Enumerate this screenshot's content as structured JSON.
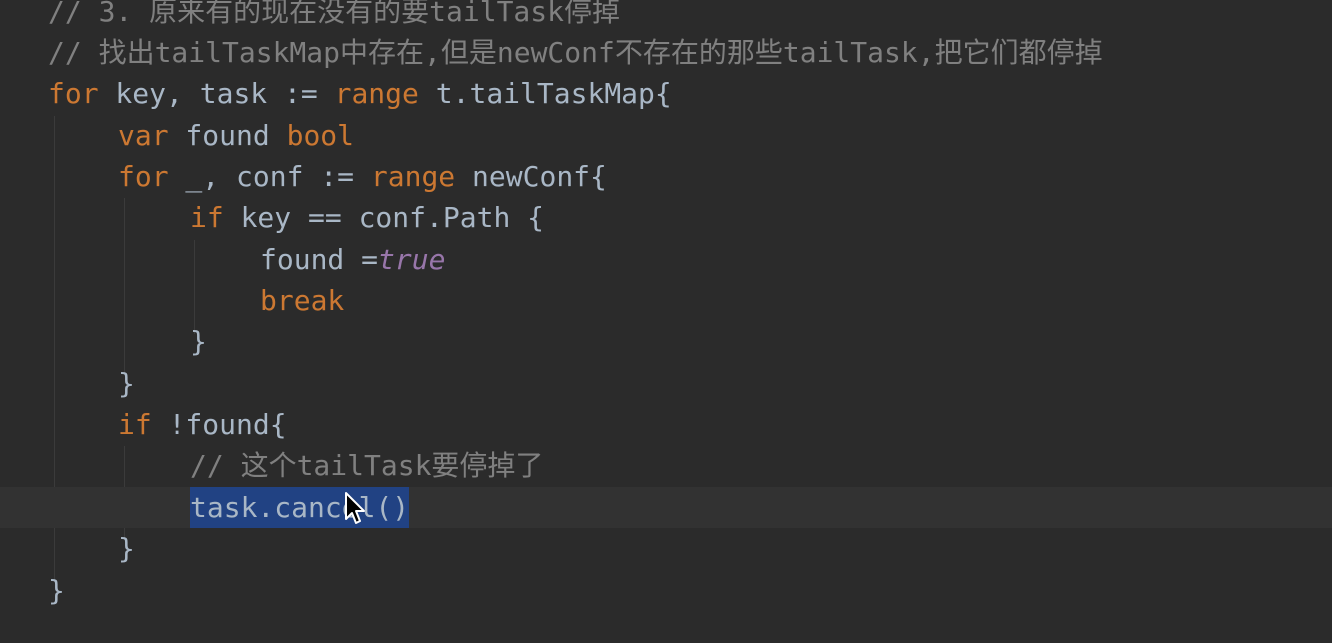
{
  "code": {
    "l0_comment": "// 3. 原来有的现在没有的要tailTask停掉",
    "l1_comment": "// 找出tailTaskMap中存在,但是newConf不存在的那些tailTask,把它们都停掉",
    "l2_kw_for": "for",
    "l2_vars": " key, task := ",
    "l2_kw_range": "range",
    "l2_rest": " t.tailTaskMap{",
    "l3_kw_var": "var",
    "l3_ident": " found ",
    "l3_type": "bool",
    "l4_kw_for": "for",
    "l4_vars": " _, conf := ",
    "l4_kw_range": "range",
    "l4_rest": " newConf{",
    "l5_kw_if": "if",
    "l5_rest": " key == conf.Path {",
    "l6_ident": "found =",
    "l6_literal": "true",
    "l7_kw_break": "break",
    "l8_brace": "}",
    "l9_brace": "}",
    "l10_kw_if": "if",
    "l10_rest": " !found{",
    "l11_comment": "// 这个tailTask要停掉了",
    "l12_selected": "task.cancel()",
    "l13_brace": "}",
    "l14_brace": "}"
  },
  "colors": {
    "background": "#2b2b2b",
    "current_line": "#323232",
    "keyword": "#cc7832",
    "comment": "#808080",
    "literal": "#9876aa",
    "text": "#a9b7c6",
    "selection": "#214283"
  },
  "icons": {
    "cursor": "mouse-pointer-icon"
  }
}
